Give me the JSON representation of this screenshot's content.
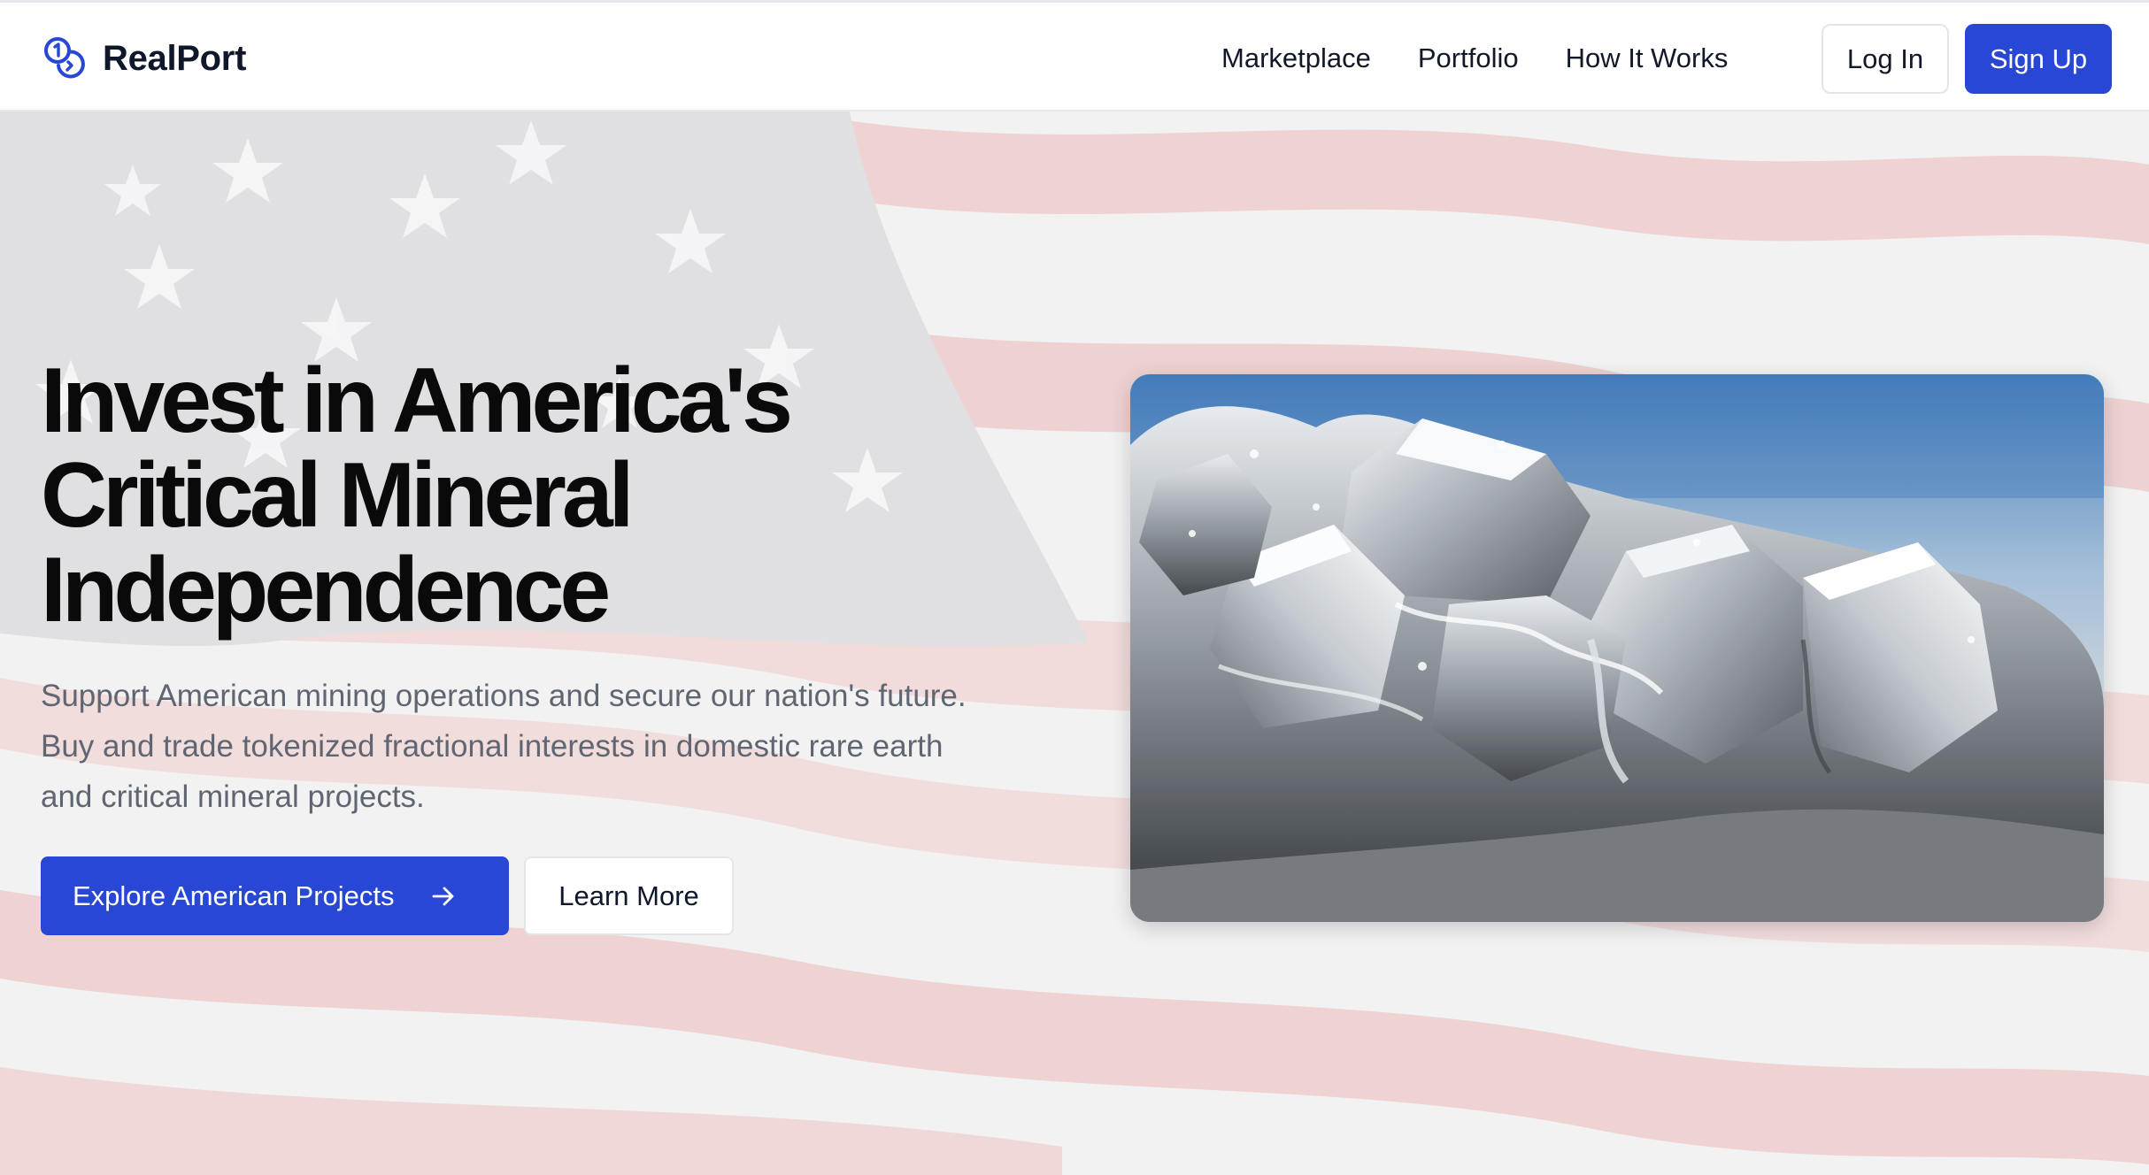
{
  "header": {
    "brand_name": "RealPort",
    "nav": [
      {
        "label": "Marketplace"
      },
      {
        "label": "Portfolio"
      },
      {
        "label": "How It Works"
      }
    ],
    "login_label": "Log In",
    "signup_label": "Sign Up"
  },
  "hero": {
    "title_lines": [
      "Invest in America's",
      "Critical Mineral",
      "Independence"
    ],
    "subtitle_lines": [
      "Support American mining operations and secure our nation's future.",
      "Buy and trade tokenized fractional interests in domestic rare earth",
      "and critical mineral projects."
    ],
    "primary_cta": "Explore American Projects",
    "secondary_cta": "Learn More",
    "background_image": "american-flag",
    "feature_image": "silver-metallic-mineral-crystal"
  },
  "icons": {
    "logo": "coins-logo-icon",
    "cta_arrow": "arrow-right-icon"
  },
  "colors": {
    "brand_blue": "#2747d4",
    "heading": "#0a0a0a",
    "subtitle": "#5f6672",
    "flag_red": "#b22234",
    "flag_blue": "#3c3b6e"
  }
}
